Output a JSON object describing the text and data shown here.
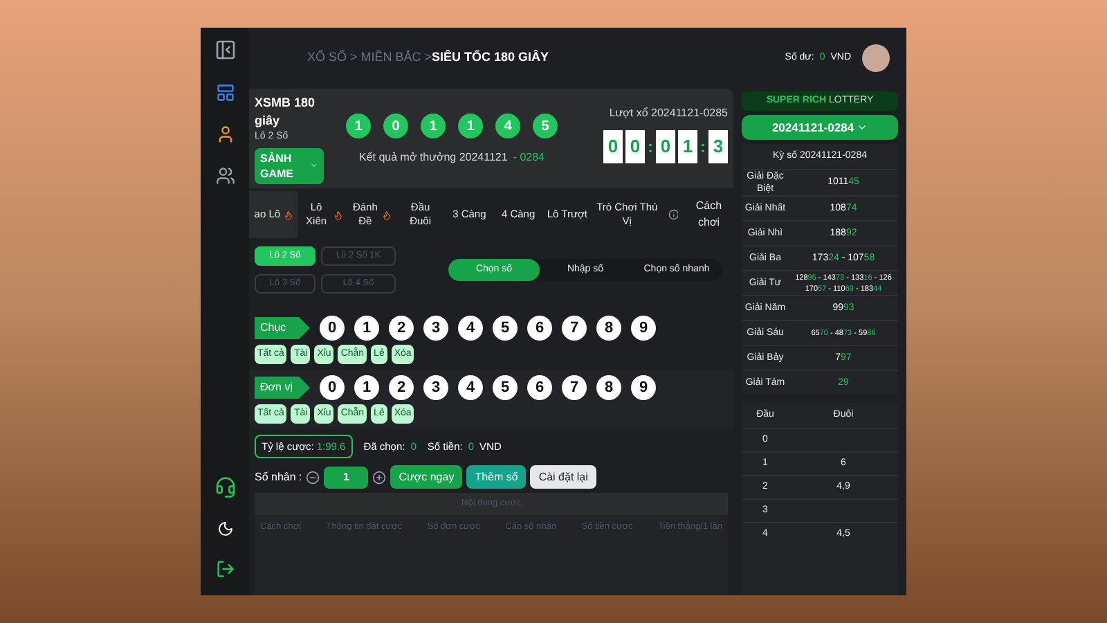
{
  "header": {
    "breadcrumb": "XỔ SỐ > MIỀN BẮC > ",
    "current": "SIÊU TỐC 180 GIÂY",
    "balance_label": "Số dư:",
    "balance": "0",
    "currency": "VND"
  },
  "game": {
    "title": "XSMB 180 giây",
    "subtitle": "Lô 2 Số",
    "lobby_button": "SẢNH GAME",
    "balls": [
      "1",
      "0",
      "1",
      "1",
      "4",
      "5"
    ],
    "result_label": "Kết quả mở thưởng 20241121",
    "result_period": "- 0284",
    "next_label": "Lượt xổ 20241121-0285",
    "timer": [
      {
        "kind": "digit",
        "text": "0"
      },
      {
        "kind": "digit",
        "text": "0"
      },
      {
        "kind": "colon",
        "text": ":"
      },
      {
        "kind": "digit",
        "text": "0"
      },
      {
        "kind": "digit",
        "text": "1"
      },
      {
        "kind": "colon",
        "text": ":"
      },
      {
        "kind": "digit",
        "text": "3"
      }
    ]
  },
  "tabs": [
    {
      "label": "ao Lô",
      "hot": true,
      "selected": true
    },
    {
      "label": "Lô Xiên",
      "hot": true,
      "selected": false
    },
    {
      "label": "Đánh Đề",
      "hot": true,
      "selected": false
    },
    {
      "label": "Đầu Đuôi",
      "hot": false,
      "selected": false
    },
    {
      "label": "3 Càng",
      "hot": false,
      "selected": false
    },
    {
      "label": "4 Càng",
      "hot": false,
      "selected": false
    },
    {
      "label": "Lô Trượt",
      "hot": false,
      "selected": false
    },
    {
      "label": "Trò Chơi Thú Vị",
      "hot": false,
      "selected": false
    }
  ],
  "how_to_play": "Cách chơi",
  "sub_tabs": [
    {
      "label": "Lô 2 Số",
      "selected": true
    },
    {
      "label": "Lô 2 Số 1K",
      "selected": false
    },
    {
      "label": "Lô 3 Số",
      "selected": false
    },
    {
      "label": "Lô 4 Số",
      "selected": false
    }
  ],
  "modes": [
    {
      "label": "Chọn số",
      "selected": true
    },
    {
      "label": "Nhập số",
      "selected": false
    },
    {
      "label": "Chọn số nhanh",
      "selected": false
    }
  ],
  "pickers": [
    {
      "label": "Chục",
      "digits": [
        "0",
        "1",
        "2",
        "3",
        "4",
        "5",
        "6",
        "7",
        "8",
        "9"
      ],
      "quick": [
        "Tất cả",
        "Tài",
        "Xỉu",
        "Chẵn",
        "Lẻ",
        "Xóa"
      ]
    },
    {
      "label": "Đơn vị",
      "digits": [
        "0",
        "1",
        "2",
        "3",
        "4",
        "5",
        "6",
        "7",
        "8",
        "9"
      ],
      "quick": [
        "Tất cả",
        "Tài",
        "Xỉu",
        "Chẵn",
        "Lẻ",
        "Xóa"
      ]
    }
  ],
  "summary": {
    "odds_label": "Tỷ lệ cược:",
    "odds": "1:99.6",
    "chosen_label": "Đã chọn:",
    "chosen": "0",
    "amount_label": "Số tiền:",
    "amount": "0",
    "currency": "VND"
  },
  "multiplier": {
    "label": "Số nhân :",
    "value": "1"
  },
  "actions": [
    {
      "label": "Cược ngay",
      "kind": "primary"
    },
    {
      "label": "Thêm số",
      "kind": "teal"
    },
    {
      "label": "Cài đặt lại",
      "kind": "light"
    }
  ],
  "bet_table": {
    "title": "Nội dung cược",
    "columns": [
      "Cách chơi",
      "Thông tin đặt cược",
      "Số đơn cược",
      "Cấp số nhân",
      "Số tiền cược",
      "Tiền thắng/1 lần"
    ]
  },
  "results": {
    "brand_main": "SUPER RICH",
    "brand_sub": "LOTTERY",
    "period_select": "20241121-0284",
    "period_label": "Kỳ số 20241121-0284",
    "prizes": [
      {
        "name": "Giải Đặc Biệt",
        "lines": [
          [
            {
              "text": "1011",
              "win": false
            },
            {
              "text": "45",
              "win": true
            }
          ]
        ]
      },
      {
        "name": "Giải Nhất",
        "lines": [
          [
            {
              "text": "108",
              "win": false
            },
            {
              "text": "74",
              "win": true
            }
          ]
        ]
      },
      {
        "name": "Giải Nhì",
        "lines": [
          [
            {
              "text": "188",
              "win": false
            },
            {
              "text": "92",
              "win": true
            }
          ]
        ]
      },
      {
        "name": "Giải Ba",
        "lines": [
          [
            {
              "text": "173",
              "win": false
            },
            {
              "text": "24",
              "win": true
            },
            {
              "text": " - 107",
              "win": false
            },
            {
              "text": "58",
              "win": true
            }
          ]
        ]
      },
      {
        "name": "Giải Tư",
        "lines": [
          [
            {
              "text": "128",
              "win": false
            },
            {
              "text": "95",
              "win": true
            },
            {
              "text": " - 143",
              "win": false
            },
            {
              "text": "73",
              "win": true
            },
            {
              "text": " - 133",
              "win": false
            },
            {
              "text": "16",
              "win": true
            },
            {
              "text": " - 126",
              "win": false
            }
          ],
          [
            {
              "text": "170",
              "win": false
            },
            {
              "text": "57",
              "win": true
            },
            {
              "text": " - 110",
              "win": false
            },
            {
              "text": "69",
              "win": true
            },
            {
              "text": " - 183",
              "win": false
            },
            {
              "text": "44",
              "win": true
            }
          ]
        ]
      },
      {
        "name": "Giải Năm",
        "lines": [
          [
            {
              "text": "99",
              "win": false
            },
            {
              "text": "93",
              "win": true
            }
          ]
        ]
      },
      {
        "name": "Giải Sáu",
        "lines": [
          [
            {
              "text": "65",
              "win": false
            },
            {
              "text": "70",
              "win": true
            },
            {
              "text": " - 48",
              "win": false
            },
            {
              "text": "73",
              "win": true
            },
            {
              "text": " - 59",
              "win": false
            },
            {
              "text": "86",
              "win": true
            }
          ]
        ]
      },
      {
        "name": "Giải Bảy",
        "lines": [
          [
            {
              "text": "7",
              "win": false
            },
            {
              "text": "97",
              "win": true
            }
          ]
        ]
      },
      {
        "name": "Giải Tám",
        "lines": [
          [
            {
              "text": "29",
              "win": true
            }
          ]
        ]
      }
    ],
    "head_tail": {
      "columns": [
        "Đầu",
        "Đuôi"
      ],
      "rows": [
        [
          "0",
          ""
        ],
        [
          "1",
          "6"
        ],
        [
          "2",
          "4,9"
        ],
        [
          "3",
          ""
        ],
        [
          "4",
          "4,5"
        ]
      ]
    }
  }
}
